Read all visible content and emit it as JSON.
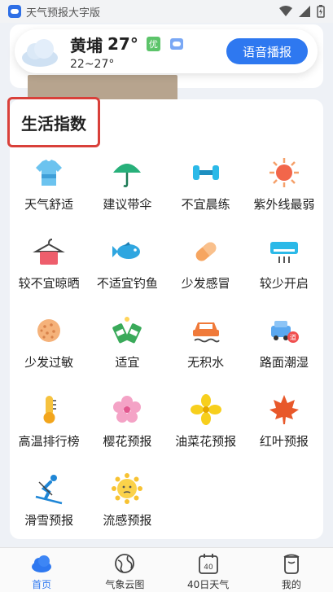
{
  "status_bar": {
    "app_name": "天气预报大字版"
  },
  "header": {
    "city": "黄埔",
    "temperature": "27°",
    "aqi_badge": "优",
    "temp_range": "22~27°",
    "voice_button": "语音播报"
  },
  "section": {
    "title": "生活指数",
    "items": [
      {
        "label": "天气舒适",
        "icon": "shirt-icon"
      },
      {
        "label": "建议带伞",
        "icon": "umbrella-icon"
      },
      {
        "label": "不宜晨练",
        "icon": "dumbbell-icon"
      },
      {
        "label": "紫外线最弱",
        "icon": "sun-icon"
      },
      {
        "label": "较不宜晾晒",
        "icon": "clothes-hanger-icon"
      },
      {
        "label": "不适宜钓鱼",
        "icon": "fish-icon"
      },
      {
        "label": "少发感冒",
        "icon": "pill-icon"
      },
      {
        "label": "较少开启",
        "icon": "air-conditioner-icon"
      },
      {
        "label": "少发过敏",
        "icon": "pollen-icon"
      },
      {
        "label": "适宜",
        "icon": "beer-cheers-icon"
      },
      {
        "label": "无积水",
        "icon": "car-water-icon"
      },
      {
        "label": "路面潮湿",
        "icon": "road-car-icon"
      },
      {
        "label": "高温排行榜",
        "icon": "thermometer-icon"
      },
      {
        "label": "樱花预报",
        "icon": "cherry-blossom-icon"
      },
      {
        "label": "油菜花预报",
        "icon": "rapeseed-flower-icon"
      },
      {
        "label": "红叶预报",
        "icon": "maple-leaf-icon"
      },
      {
        "label": "滑雪预报",
        "icon": "skiing-icon"
      },
      {
        "label": "流感预报",
        "icon": "flu-sun-icon"
      }
    ]
  },
  "tabs": [
    {
      "label": "首页",
      "icon": "home-cloud-icon",
      "active": true
    },
    {
      "label": "气象云图",
      "icon": "globe-icon",
      "active": false
    },
    {
      "label": "40日天气",
      "icon": "calendar-40-icon",
      "active": false,
      "icon_text": "40"
    },
    {
      "label": "我的",
      "icon": "profile-icon",
      "active": false
    }
  ],
  "colors": {
    "accent": "#2e78f0",
    "highlight_box": "#d9403a",
    "aqi_good": "#5cc46a"
  }
}
